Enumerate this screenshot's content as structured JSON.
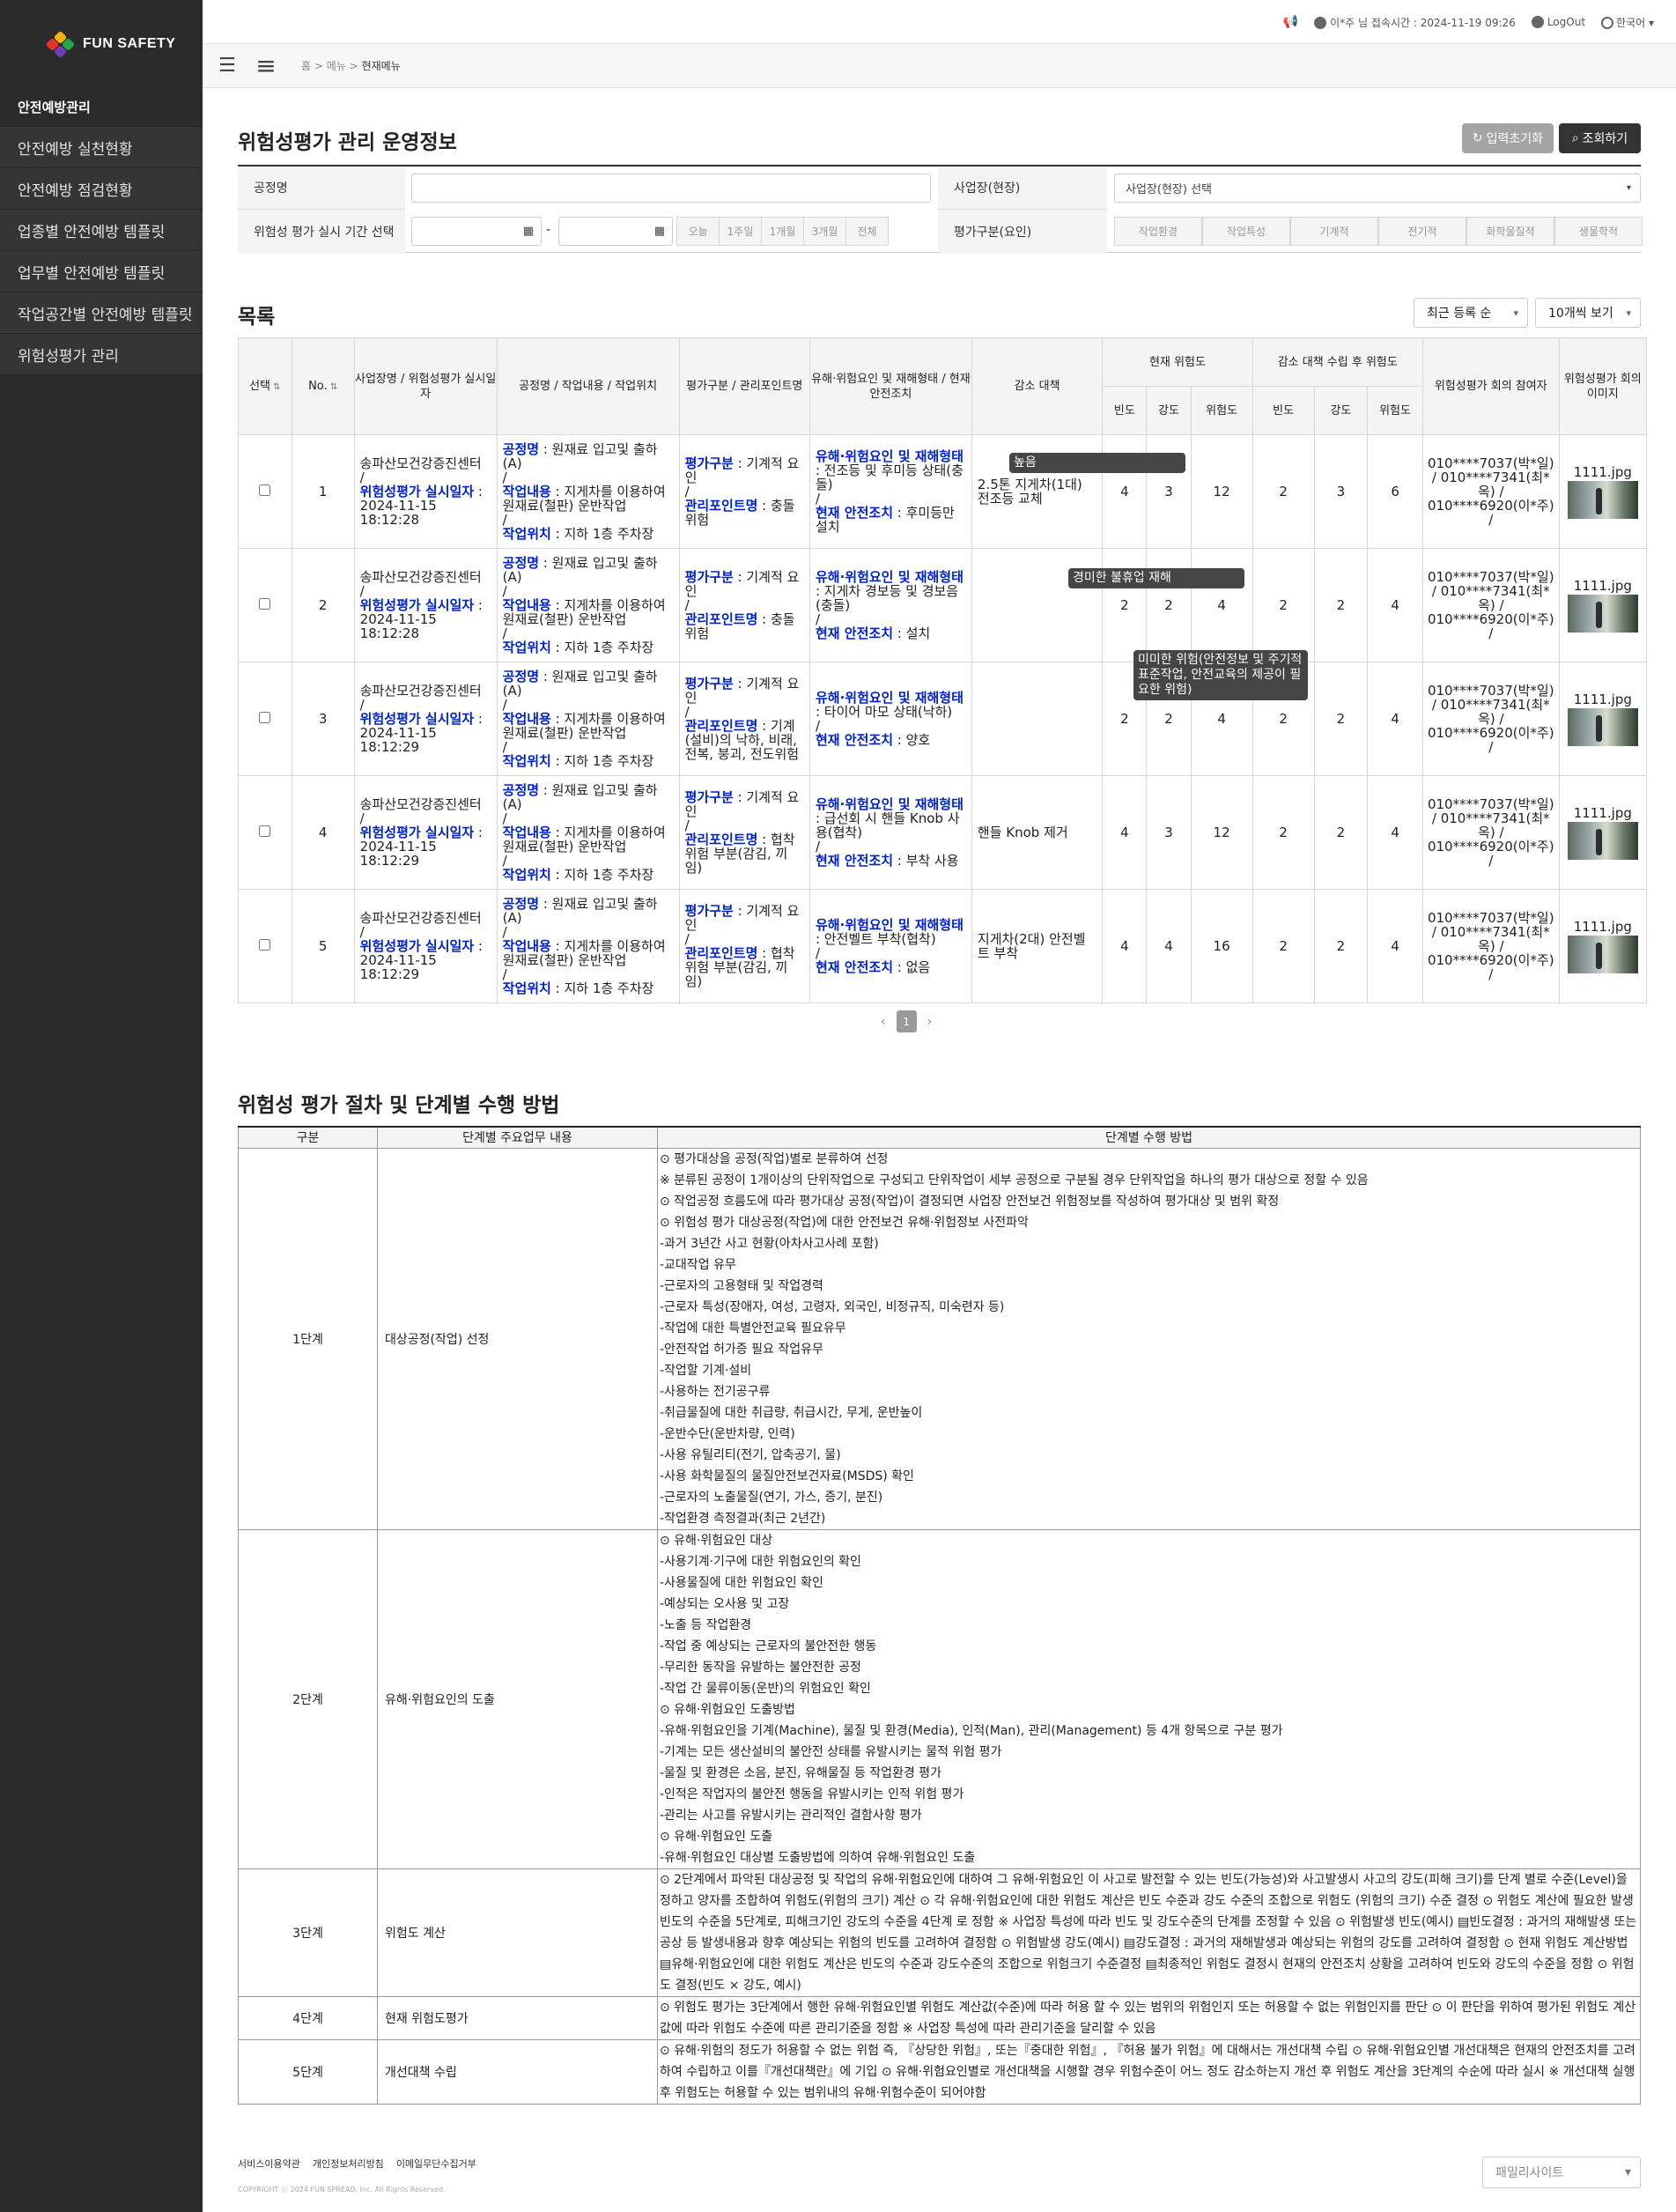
{
  "logo": {
    "text": "FUN SAFETY"
  },
  "sidebar": {
    "items": [
      {
        "label": "안전예방관리",
        "head": true
      },
      {
        "label": "안전예방 실천현황"
      },
      {
        "label": "안전예방 점검현황"
      },
      {
        "label": "업종별 안전예방 템플릿"
      },
      {
        "label": "업무별 안전예방 템플릿"
      },
      {
        "label": "작업공간별 안전예방 템플릿"
      },
      {
        "label": "위험성평가 관리"
      }
    ]
  },
  "topbar": {
    "user": "이*주 님 접속시간 : 2024-11-19 09:26",
    "logout": "LogOut",
    "lang": "한국어"
  },
  "breadcrumb": {
    "home": "홈",
    "sep": ">",
    "level1": "메뉴",
    "current": "현재메뉴"
  },
  "header": {
    "title": "위험성평가 관리 운영정보",
    "reset_label": "입력초기화",
    "search_label": "조회하기"
  },
  "filter": {
    "process_label": "공정명",
    "process_value": "",
    "site_label": "사업장(현장)",
    "site_value": "사업장(현장) 선택",
    "date_label": "위험성 평가 실시 기간 선택",
    "date_sep": "-",
    "quick": [
      "오늘",
      "1주일",
      "1개월",
      "3개월",
      "전체"
    ],
    "type_label": "평가구분(요인)",
    "types": [
      "작업환경",
      "작업특성",
      "기계적",
      "전기적",
      "화학물질적",
      "생물학적"
    ]
  },
  "list": {
    "title": "목록",
    "sort": "최근 등록 순",
    "per_page": "10개씩 보기"
  },
  "columns": {
    "select": "선택",
    "no": "No.",
    "site": "사업장명 / 위험성평가 실시일자",
    "process": "공정명 / 작업내용 / 작업위치",
    "category": "평가구분 / 관리포인트명",
    "hazard": "유해·위험요인 및 재해형태 / 현재 안전조치",
    "reduce": "감소 대책",
    "current": "현재 위험도",
    "after": "감소 대책 수립 후 위험도",
    "freq": "빈도",
    "sev": "강도",
    "risk": "위험도",
    "participants": "위험성평가 회의 참여자",
    "image": "위험성평가 회의 이미지"
  },
  "labels": {
    "process": "공정명",
    "date": "위험성평가 실시일자",
    "work": "작업내용",
    "loc": "작업위치",
    "cat": "평가구분",
    "point": "관리포인트명",
    "hazard": "유해·위험요인 및 재해형태",
    "safety": "현재 안전조치"
  },
  "rows": [
    {
      "no": "1",
      "site": "송파산모건강증진센터",
      "date": "2024-11-15 18:12:28",
      "process": "원재료 입고및 출하(A)",
      "work": "지게차를 이용하여 원재료(철판) 운반작업",
      "loc": "지하 1층 주차장",
      "cat": "기계적 요인",
      "point": "충돌위험",
      "hazard": "전조등 및 후미등 상태(충돌)",
      "safety": "후미등만 설치",
      "reduce": "2.5톤 지게차(1대) 전조등 교체",
      "f1": "4",
      "s1": "3",
      "r1": "12",
      "f2": "2",
      "s2": "3",
      "r2": "6",
      "participants": "010****7037(박*일) / 010****7341(최*옥) / 010****6920(이*주) /",
      "image": "1111.jpg"
    },
    {
      "no": "2",
      "site": "송파산모건강증진센터",
      "date": "2024-11-15 18:12:28",
      "process": "원재료 입고및 출하(A)",
      "work": "지게차를 이용하여 원재료(철판) 운반작업",
      "loc": "지하 1층 주차장",
      "cat": "기계적 요인",
      "point": "충돌위험",
      "hazard": "지게차 경보등 및 경보음(충돌)",
      "safety": "설치",
      "reduce": "",
      "f1": "2",
      "s1": "2",
      "r1": "4",
      "f2": "2",
      "s2": "2",
      "r2": "4",
      "participants": "010****7037(박*일) / 010****7341(최*옥) / 010****6920(이*주) /",
      "image": "1111.jpg"
    },
    {
      "no": "3",
      "site": "송파산모건강증진센터",
      "date": "2024-11-15 18:12:29",
      "process": "원재료 입고및 출하(A)",
      "work": "지게차를 이용하여 원재료(철판) 운반작업",
      "loc": "지하 1층 주차장",
      "cat": "기계적 요인",
      "point": "기계(설비)의 낙하, 비래, 전복, 붕괴, 전도위험",
      "hazard": "타이어 마모 상태(낙하)",
      "safety": "양호",
      "reduce": "",
      "f1": "2",
      "s1": "2",
      "r1": "4",
      "f2": "2",
      "s2": "2",
      "r2": "4",
      "participants": "010****7037(박*일) / 010****7341(최*옥) / 010****6920(이*주) /",
      "image": "1111.jpg"
    },
    {
      "no": "4",
      "site": "송파산모건강증진센터",
      "date": "2024-11-15 18:12:29",
      "process": "원재료 입고및 출하(A)",
      "work": "지게차를 이용하여 원재료(철판) 운반작업",
      "loc": "지하 1층 주차장",
      "cat": "기계적 요인",
      "point": "협착위험 부분(감김, 끼임)",
      "hazard": "급선회 시 핸들 Knob 사용(협착)",
      "safety": "부착 사용",
      "reduce": "핸들 Knob 제거",
      "f1": "4",
      "s1": "3",
      "r1": "12",
      "f2": "2",
      "s2": "2",
      "r2": "4",
      "participants": "010****7037(박*일) / 010****7341(최*옥) / 010****6920(이*주) /",
      "image": "1111.jpg"
    },
    {
      "no": "5",
      "site": "송파산모건강증진센터",
      "date": "2024-11-15 18:12:29",
      "process": "원재료 입고및 출하(A)",
      "work": "지게차를 이용하여 원재료(철판) 운반작업",
      "loc": "지하 1층 주차장",
      "cat": "기계적 요인",
      "point": "협착위험 부분(감김, 끼임)",
      "hazard": "안전벨트 부착(협착)",
      "safety": "없음",
      "reduce": "지게차(2대) 안전벨트 부착",
      "f1": "4",
      "s1": "4",
      "r1": "16",
      "f2": "2",
      "s2": "2",
      "r2": "4",
      "participants": "010****7037(박*일) / 010****7341(최*옥) / 010****6920(이*주) /",
      "image": "1111.jpg"
    }
  ],
  "tooltips": [
    "높음",
    "경미한 불휴업 재해",
    "미미한 위험(안전정보 및 주기적 표준작업, 안전교육의 제공이 필요한 위험)"
  ],
  "pager": {
    "current": "1"
  },
  "procedure": {
    "title": "위험성 평가 절차 및 단계별 수행 방법",
    "headers": [
      "구분",
      "단계별 주요업무 내용",
      "단계별 수행 방법"
    ],
    "steps": [
      {
        "stage": "1단계",
        "task": "대상공정(작업) 선정",
        "lines": [
          "⊙ 평가대상을 공정(작업)별로 분류하여 선정",
          "※ 분류된 공정이 1개이상의 단위작업으로 구성되고 단위작업이 세부 공정으로 구분될 경우 단위작업을 하나의 평가 대상으로 정할 수 있음",
          "⊙ 작업공정 흐름도에 따라 평가대상 공정(작업)이 결정되면 사업장 안전보건 위험정보를 작성하여 평가대상 및 범위 확정",
          "⊙ 위험성 평가 대상공정(작업)에 대한 안전보건 유해·위험정보 사전파악",
          "-과거 3년간 사고 현황(아차사고사례 포함)",
          "-교대작업 유무",
          "-근로자의 고용형태 및 작업경력",
          "-근로자 특성(장애자, 여성, 고령자, 외국인, 비정규직, 미숙련자 등)",
          "-작업에 대한 특별안전교육 필요유무",
          "-안전작업 허가증 필요 작업유무",
          "-작업할 기계·설비",
          "-사용하는 전기공구류",
          "-취급물질에 대한 취급량, 취급시간, 무게, 운반높이",
          "-운반수단(운반차량, 인력)",
          "-사용 유틸리티(전기, 압축공기, 물)",
          "-사용 화학물질의 물질안전보건자료(MSDS) 확인",
          "-근로자의 노출물질(연기, 가스, 증기, 분진)",
          "-작업환경 측정결과(최근 2년간)"
        ]
      },
      {
        "stage": "2단계",
        "task": "유해·위험요인의 도출",
        "lines": [
          "⊙ 유해·위험요인 대상",
          "-사용기계·기구에 대한 위험요인의 확인",
          "-사용물질에 대한 위험요인 확인",
          "-예상되는 오사용 및 고장",
          "-노출 등 작업환경",
          "-작업 중 예상되는 근로자의 불안전한 행동",
          "-무리한 동작을 유발하는 불안전한 공정",
          "-작업 간 물류이동(운반)의 위험요인 확인",
          "⊙ 유해·위험요인 도출방법",
          "-유해·위험요인을 기계(Machine), 물질 및 환경(Media), 인적(Man), 관리(Management) 등 4개 항목으로 구분 평가",
          "-기계는 모든 생산설비의 불안전 상태를 유발시키는 물적 위험 평가",
          "-물질 및 환경은 소음, 분진, 유해물질 등 작업환경 평가",
          "-인적은 작업자의 불안전 행동을 유발시키는 인적 위험 평가",
          "-관리는 사고를 유발시키는 관리적인 결함사항 평가",
          "⊙ 유해·위험요인 도출",
          "-유해·위험요인 대상별 도출방법에 의하여 유해·위험요인 도출"
        ]
      },
      {
        "stage": "3단계",
        "task": "위험도 계산",
        "lines": [
          "⊙ 2단계에서 파악된 대상공정 및 작업의 유해·위험요인에 대하여 그 유해·위험요인 이 사고로 발전할 수 있는 빈도(가능성)와 사고발생시 사고의 강도(피해 크기)를 단계 별로 수준(Level)을 정하고 양자를 조합하여 위험도(위험의 크기) 계산 ⊙ 각 유해·위험요인에 대한 위험도 계산은 빈도 수준과 강도 수준의 조합으로 위험도 (위험의 크기) 수준 결정 ⊙ 위험도 계산에 필요한 발생빈도의 수준을 5단계로, 피해크기인 강도의 수준을 4단계 로 정함 ※ 사업장 특성에 따라 빈도 및 강도수준의 단계를 조정할 수 있음 ⊙ 위험발생 빈도(예시) ▤빈도결정 : 과거의 재해발생 또는 공상 등 발생내용과 향후 예상되는 위험의 빈도를 고려하여 결정함 ⊙ 위험발생 강도(예시) ▤강도결정 : 과거의 재해발생과 예상되는 위험의 강도를 고려하여 결정함 ⊙ 현재 위험도 계산방법 ▤유해·위험요인에 대한 위험도 계산은 빈도의 수준과 강도수준의 조합으로 위험크기 수준결정 ▤최종적인 위험도 결정시 현재의 안전조치 상황을 고려하여 빈도와 강도의 수준을 정함 ⊙ 위험도 결정(빈도 × 강도, 예시)"
        ]
      },
      {
        "stage": "4단계",
        "task": "현재 위험도평가",
        "lines": [
          "⊙ 위험도 평가는 3단계에서 행한 유해·위험요인별 위험도 계산값(수준)에 따라 허용 할 수 있는 범위의 위험인지 또는 허용할 수 없는 위험인지를 판단 ⊙ 이 판단을 위하여 평가된 위험도 계산값에 따라 위험도 수준에 따른 관리기준을 정함 ※ 사업장 특성에 따라 관리기준을 달리할 수 있음"
        ]
      },
      {
        "stage": "5단계",
        "task": "개선대책 수립",
        "lines": [
          "⊙ 유해·위험의 정도가 허용할 수 없는 위험 즉, 『상당한 위험』, 또는『중대한 위험』, 『허용 불가 위험』에 대해서는 개선대책 수립 ⊙ 유해·위험요인별 개선대책은 현재의 안전조치를 고려하여 수립하고 이를『개선대책란』에 기입 ⊙ 유해·위험요인별로 개선대책을 시행할 경우 위험수준이 어느 정도 감소하는지 개선 후 위험도 계산을 3단계의 수순에 따라 실시 ※ 개선대책 실행 후 위험도는 허용할 수 있는 범위내의 유해·위험수준이 되어야함"
        ]
      }
    ]
  },
  "footer": {
    "links": [
      "서비스이용약관",
      "개인정보처리방침",
      "이메일무단수집거부"
    ],
    "copyright": "COPYRIGHT ⓒ 2024 FUN SPREAD, Inc. All Rights Reserved.",
    "family": "패밀리사이트"
  }
}
